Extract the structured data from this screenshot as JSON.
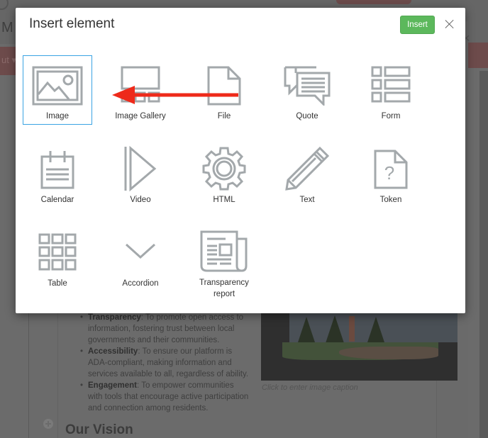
{
  "background": {
    "app_title_fragment": "M L",
    "toolbar_fragment": "ut ▾",
    "list_items": [
      {
        "term": "Transparency",
        "text": ": To promote open access to information, fostering trust between local governments and their communities."
      },
      {
        "term": "Accessibility",
        "text": ": To ensure our platform is ADA-compliant, making information and services available to all, regardless of ability."
      },
      {
        "term": "Engagement",
        "text": ": To empower communities with tools that encourage active participation and connection among residents."
      }
    ],
    "section_heading": "Our Vision",
    "image_caption_placeholder": "Click to enter image caption",
    "add_block_icon": "plus-circle-icon"
  },
  "modal": {
    "title": "Insert element",
    "insert_label": "Insert",
    "close_icon": "close-icon",
    "insert_color": "#5cb85c",
    "selected_color": "#3aa3e3",
    "annotation_arrow_color": "#ee2a1a",
    "selected_element": "Image",
    "elements": [
      {
        "id": "image",
        "label": "Image",
        "icon": "image-icon"
      },
      {
        "id": "image-gallery",
        "label": "Image Gallery",
        "icon": "image-gallery-icon"
      },
      {
        "id": "file",
        "label": "File",
        "icon": "file-icon"
      },
      {
        "id": "quote",
        "label": "Quote",
        "icon": "quote-icon"
      },
      {
        "id": "form",
        "label": "Form",
        "icon": "form-icon"
      },
      {
        "id": "calendar",
        "label": "Calendar",
        "icon": "calendar-icon"
      },
      {
        "id": "video",
        "label": "Video",
        "icon": "video-icon"
      },
      {
        "id": "html",
        "label": "HTML",
        "icon": "gear-icon"
      },
      {
        "id": "text",
        "label": "Text",
        "icon": "pencil-icon"
      },
      {
        "id": "token",
        "label": "Token",
        "icon": "question-file-icon"
      },
      {
        "id": "table",
        "label": "Table",
        "icon": "table-grid-icon"
      },
      {
        "id": "accordion",
        "label": "Accordion",
        "icon": "chevron-down-icon"
      },
      {
        "id": "transparency-report",
        "label": "Transparency report",
        "icon": "newspaper-icon"
      }
    ]
  }
}
